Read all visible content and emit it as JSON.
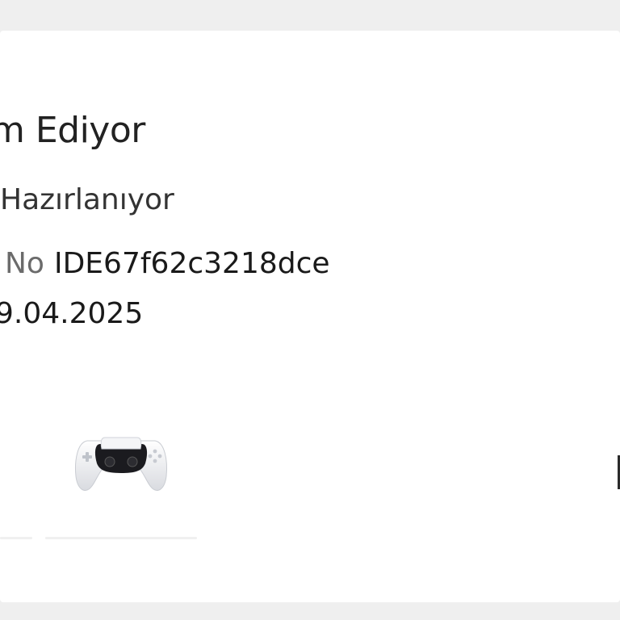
{
  "order": {
    "status_title": "m Ediyor",
    "status_subtitle": "Hazırlanıyor",
    "order_no_label": "No",
    "order_no_value": "IDE67f62c3218dce",
    "date": "9.04.2025"
  },
  "product": {
    "image_icon": "gamepad-controller-icon"
  },
  "colors": {
    "background": "#efefef",
    "card": "#ffffff",
    "text": "#1a1a1a",
    "muted": "#6b6b6b"
  }
}
